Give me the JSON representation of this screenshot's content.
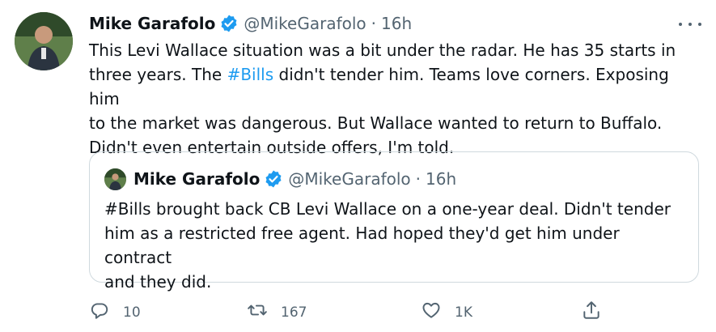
{
  "author": {
    "name": "Mike Garafolo",
    "handle": "@MikeGarafolo",
    "separator": "·",
    "time": "16h"
  },
  "tweet": {
    "text_part1": "This Levi Wallace situation was a bit under the radar. He has 35 starts in\nthree years. The ",
    "hashtag": "#Bills",
    "text_part2": " didn't tender him. Teams love corners. Exposing him\nto the market was dangerous. But Wallace wanted to return to Buffalo.\nDidn't even entertain outside offers, I'm told."
  },
  "quoted": {
    "name": "Mike Garafolo",
    "handle": "@MikeGarafolo",
    "separator": "·",
    "time": "16h",
    "text": "#Bills brought back CB Levi Wallace on a one-year deal. Didn't tender\nhim as a restricted free agent. Had hoped they'd get him under contract\nand they did."
  },
  "actions": {
    "reply_count": "10",
    "retweet_count": "167",
    "like_count": "1K"
  },
  "icons": {
    "verified": "verified-badge-icon",
    "more": "more-icon",
    "reply": "reply-icon",
    "retweet": "retweet-icon",
    "like": "like-icon",
    "share": "share-icon"
  },
  "colors": {
    "accent": "#1d9bf0",
    "text": "#0f1419",
    "secondary": "#536471",
    "border": "#cfd9de"
  }
}
